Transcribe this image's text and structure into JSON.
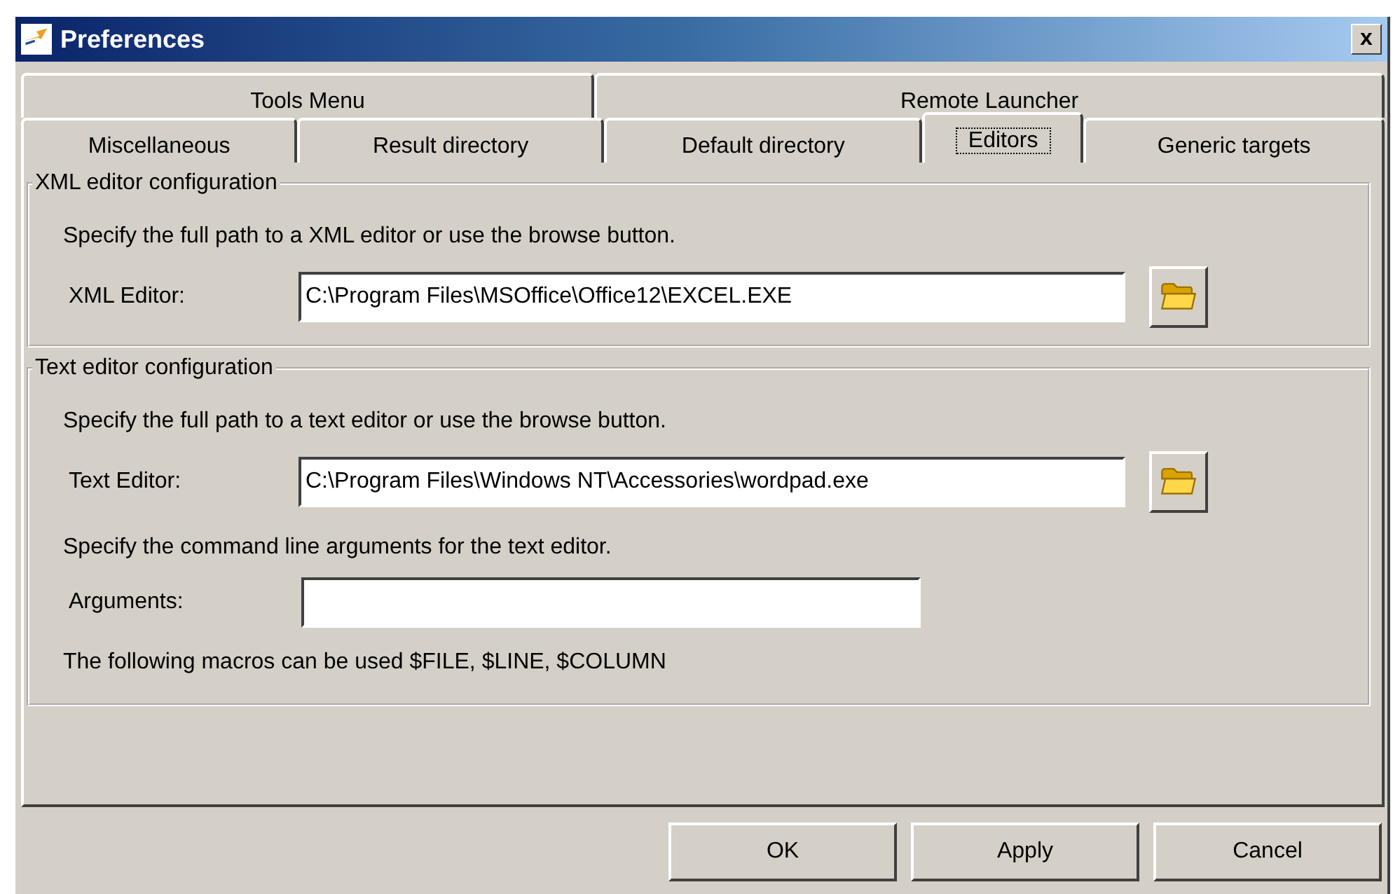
{
  "window": {
    "title": "Preferences",
    "close": "x"
  },
  "tab_rows": [
    {
      "tabs": [
        {
          "label": "Tools Menu",
          "selected": false
        },
        {
          "label": "Remote Launcher",
          "selected": false
        }
      ]
    },
    {
      "tabs": [
        {
          "label": "Miscellaneous",
          "selected": false
        },
        {
          "label": "Result directory",
          "selected": false
        },
        {
          "label": "Default directory",
          "selected": false
        },
        {
          "label": "Editors",
          "selected": true
        },
        {
          "label": "Generic targets",
          "selected": false
        }
      ]
    }
  ],
  "groups": [
    {
      "title": "XML editor configuration",
      "rows": [
        {
          "kind": "note",
          "text": "Specify the full path to a XML editor or use the browse button."
        },
        {
          "kind": "path",
          "label": "XML Editor:",
          "value": "C:\\Program Files\\MSOffice\\Office12\\EXCEL.EXE"
        }
      ]
    },
    {
      "title": "Text editor configuration",
      "rows": [
        {
          "kind": "note",
          "text": "Specify the full path to a text editor or use the browse button."
        },
        {
          "kind": "path",
          "label": "Text Editor:",
          "value": "C:\\Program Files\\Windows NT\\Accessories\\wordpad.exe"
        },
        {
          "kind": "note",
          "text": "Specify the command line arguments for the text editor."
        },
        {
          "kind": "field",
          "label": "Arguments:"
        },
        {
          "kind": "note",
          "text": "The following macros can be used $FILE, $LINE, $COLUMN"
        }
      ]
    }
  ],
  "buttons": [
    "OK",
    "Apply",
    "Cancel"
  ]
}
